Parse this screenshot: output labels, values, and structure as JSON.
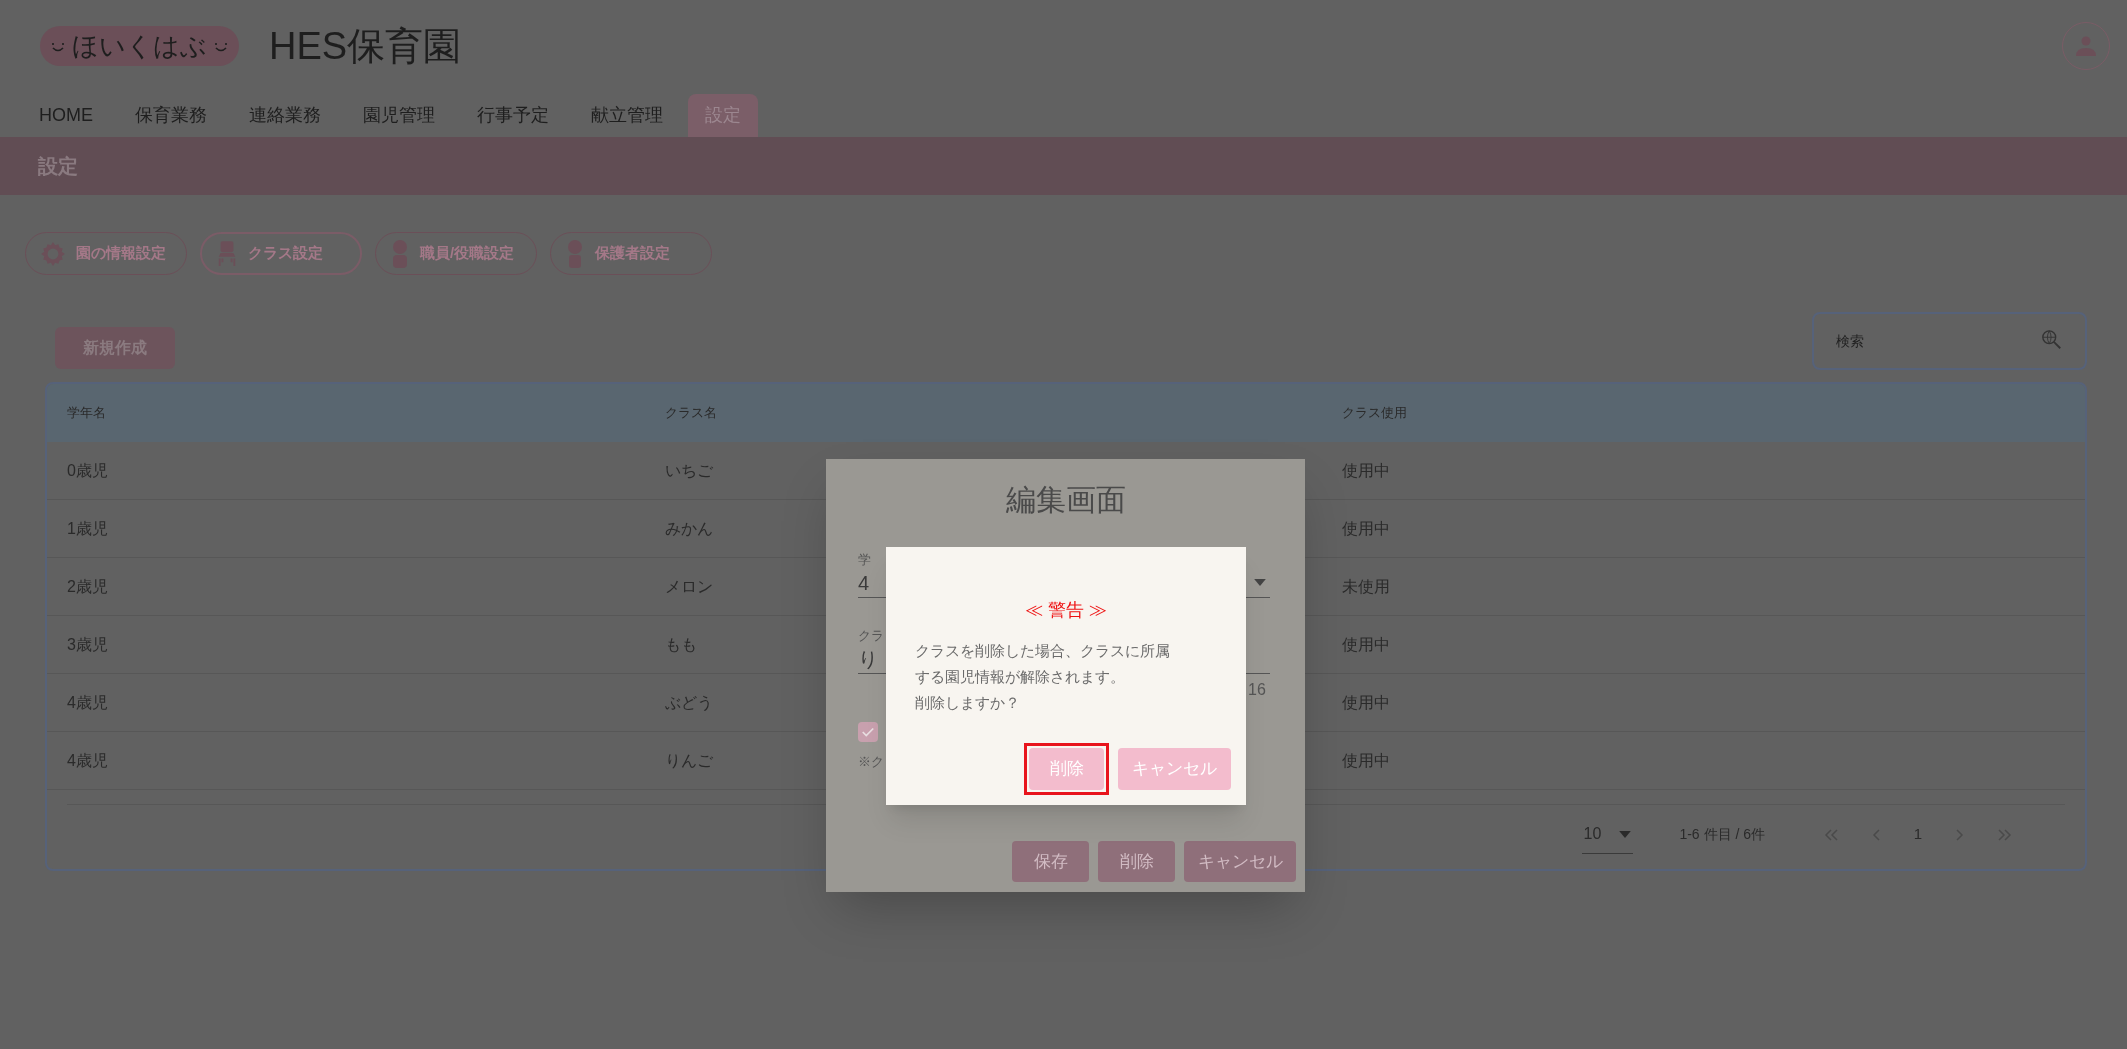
{
  "header": {
    "logo": "ほいくはぶ",
    "title": "HES保育園"
  },
  "nav": [
    {
      "label": "HOME",
      "selected": false
    },
    {
      "label": "保育業務",
      "selected": false
    },
    {
      "label": "連絡業務",
      "selected": false
    },
    {
      "label": "園児管理",
      "selected": false
    },
    {
      "label": "行事予定",
      "selected": false
    },
    {
      "label": "献立管理",
      "selected": false
    },
    {
      "label": "設定",
      "selected": true
    }
  ],
  "page_title": "設定",
  "settings_tabs": [
    {
      "label": "園の情報設定",
      "selected": false
    },
    {
      "label": "クラス設定",
      "selected": true
    },
    {
      "label": "職員/役職設定",
      "selected": false
    },
    {
      "label": "保護者設定",
      "selected": false
    }
  ],
  "new_button": "新規作成",
  "search": {
    "placeholder": "検索"
  },
  "table": {
    "columns": [
      "学年名",
      "クラス名",
      "クラス使用"
    ],
    "rows": [
      [
        "0歳児",
        "いちご",
        "使用中"
      ],
      [
        "1歳児",
        "みかん",
        "使用中"
      ],
      [
        "2歳児",
        "メロン",
        "未使用"
      ],
      [
        "3歳児",
        "もも",
        "使用中"
      ],
      [
        "4歳児",
        "ぶどう",
        "使用中"
      ],
      [
        "4歳児",
        "りんご",
        "使用中"
      ]
    ]
  },
  "pagination": {
    "page_size": "10",
    "range": "1-6 件目 / 6件",
    "page": "1"
  },
  "edit_dialog": {
    "title": "編集画面",
    "grade_label": "学",
    "grade_value": "4",
    "class_label": "クラ",
    "class_value": "り",
    "counter": "16",
    "active_checked": true,
    "note": "※ク",
    "buttons": [
      "保存",
      "削除",
      "キャンセル"
    ]
  },
  "warning_dialog": {
    "title": "≪ 警告 ≫",
    "message_lines": [
      "クラスを削除した場合、クラスに所属",
      "する園児情報が解除されます。",
      "削除しますか？"
    ],
    "buttons": [
      {
        "label": "削除",
        "focused": true
      },
      {
        "label": "キャンセル",
        "focused": false
      }
    ]
  }
}
